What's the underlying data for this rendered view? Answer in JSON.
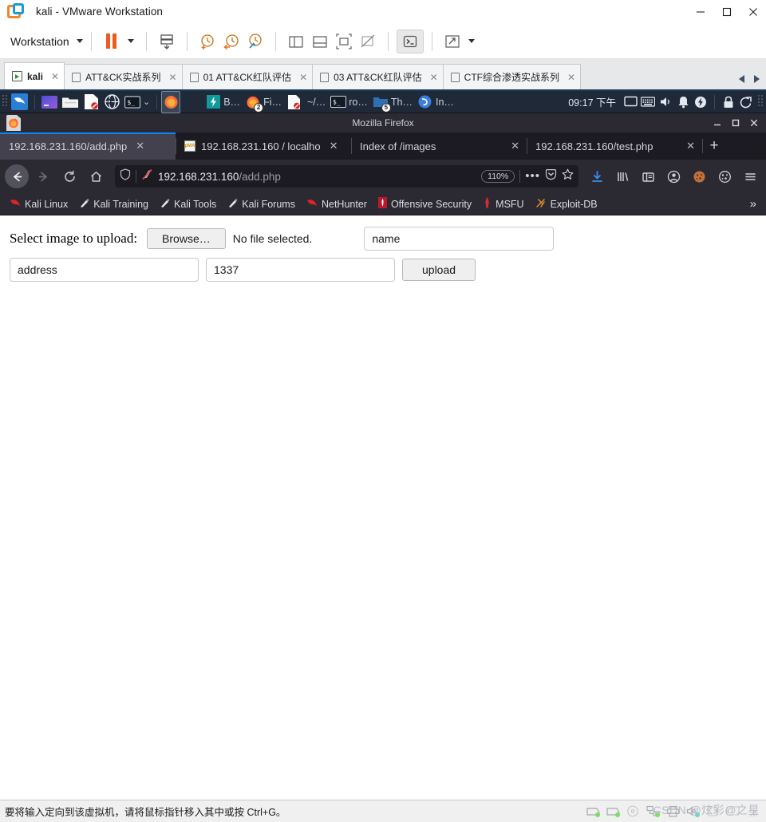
{
  "vmware": {
    "window_title": "kali - VMware Workstation",
    "window_controls": {
      "minimize": "–",
      "maximize": "□",
      "close": "✕"
    },
    "menu": {
      "workstation_label": "Workstation"
    },
    "toolbar_icons": [
      "pause-icon",
      "snapshot-icon",
      "take-snapshot-icon",
      "revert-snapshot-icon",
      "snapshot-manager-icon",
      "show-sidebar-icon",
      "show-console-view-icon",
      "fit-guest-icon",
      "no-fullscreen-icon",
      "unity-mode-icon",
      "fullscreen-icon"
    ],
    "tabs": [
      {
        "label": "kali",
        "icon": "vm-power-icon",
        "selected": true
      },
      {
        "label": "ATT&CK实战系列",
        "icon": "folder-tab-icon",
        "selected": false
      },
      {
        "label": "01 ATT&CK红队评估",
        "icon": "folder-tab-icon",
        "selected": false
      },
      {
        "label": "03 ATT&CK红队评估",
        "icon": "folder-tab-icon",
        "selected": false
      },
      {
        "label": "CTF综合渗透实战系列",
        "icon": "folder-tab-icon",
        "selected": false
      }
    ],
    "status_text": "要将输入定向到该虚拟机，请将鼠标指针移入其中或按 Ctrl+G。",
    "watermark": "CSDN @炫彩@之星"
  },
  "kali_taskbar": {
    "items": [
      {
        "name": "kali-menu-icon",
        "label": ""
      },
      {
        "name": "workspace-switcher-icon",
        "label": ""
      },
      {
        "name": "file-manager-icon",
        "label": ""
      },
      {
        "name": "text-editor-icon",
        "label": ""
      },
      {
        "name": "web-browser-icon",
        "label": ""
      },
      {
        "name": "terminal-icon",
        "label": ""
      }
    ],
    "windows": [
      {
        "name": "burpsuite-window",
        "label": "B…",
        "badge": ""
      },
      {
        "name": "firefox-window",
        "label": "Fi…",
        "badge": "2"
      },
      {
        "name": "text-editor-window",
        "label": "",
        "badge": ""
      },
      {
        "name": "home-folder-window",
        "label": "~/…",
        "badge": ""
      },
      {
        "name": "root-terminal-window",
        "label": "ro…",
        "badge": ""
      },
      {
        "name": "thunar-window",
        "label": "Th…",
        "badge": "5"
      },
      {
        "name": "intellij-window",
        "label": "In…",
        "badge": ""
      }
    ],
    "clock": "09:17 下午",
    "tray": [
      "display-icon",
      "keyboard-icon",
      "volume-icon",
      "notification-icon",
      "power-icon",
      "lock-icon",
      "logout-icon"
    ]
  },
  "firefox": {
    "window_title": "Mozilla Firefox",
    "window_controls": {
      "minimize": "_",
      "maximize": "❐",
      "close": "✕"
    },
    "tabs": [
      {
        "label": "192.168.231.160/add.php",
        "favicon": "none",
        "selected": true,
        "close": "✕"
      },
      {
        "label": "192.168.231.160 / localho",
        "favicon": "phpmyadmin-icon",
        "selected": false,
        "close": "✕"
      },
      {
        "label": "Index of /images",
        "favicon": "none",
        "selected": false,
        "close": "✕"
      },
      {
        "label": "192.168.231.160/test.php",
        "favicon": "none",
        "selected": false,
        "close": "✕"
      }
    ],
    "new_tab_label": "+",
    "nav": {
      "back": "back-arrow-icon",
      "forward": "forward-arrow-icon",
      "reload": "reload-icon",
      "home": "home-icon"
    },
    "url": {
      "host": "192.168.231.160",
      "path": "/add.php",
      "full": "192.168.231.160/add.php"
    },
    "zoom_level": "110%",
    "urlbar_icons": [
      "shield-icon",
      "insecure-connection-icon",
      "page-actions-icon",
      "pocket-icon",
      "bookmark-star-icon"
    ],
    "toolbar_icons": [
      "downloads-icon",
      "library-icon",
      "sidebar-icon",
      "account-icon",
      "cookie-manager-icon",
      "cookie-icon",
      "menu-icon"
    ],
    "bookmarks": [
      {
        "label": "Kali Linux",
        "icon": "kali-dragon-icon"
      },
      {
        "label": "Kali Training",
        "icon": "kali-tool-icon"
      },
      {
        "label": "Kali Tools",
        "icon": "kali-tool-icon"
      },
      {
        "label": "Kali Forums",
        "icon": "kali-tool-icon"
      },
      {
        "label": "NetHunter",
        "icon": "kali-dragon-icon"
      },
      {
        "label": "Offensive Security",
        "icon": "offsec-icon"
      },
      {
        "label": "MSFU",
        "icon": "metasploit-icon"
      },
      {
        "label": "Exploit-DB",
        "icon": "exploitdb-icon"
      }
    ],
    "bookmarks_overflow": "»"
  },
  "page": {
    "upload_label": "Select image to upload:",
    "browse_button": "Browse…",
    "file_status": "No file selected.",
    "name_value": "name",
    "address_value": "address",
    "port_value": "1337",
    "upload_button": "upload"
  }
}
